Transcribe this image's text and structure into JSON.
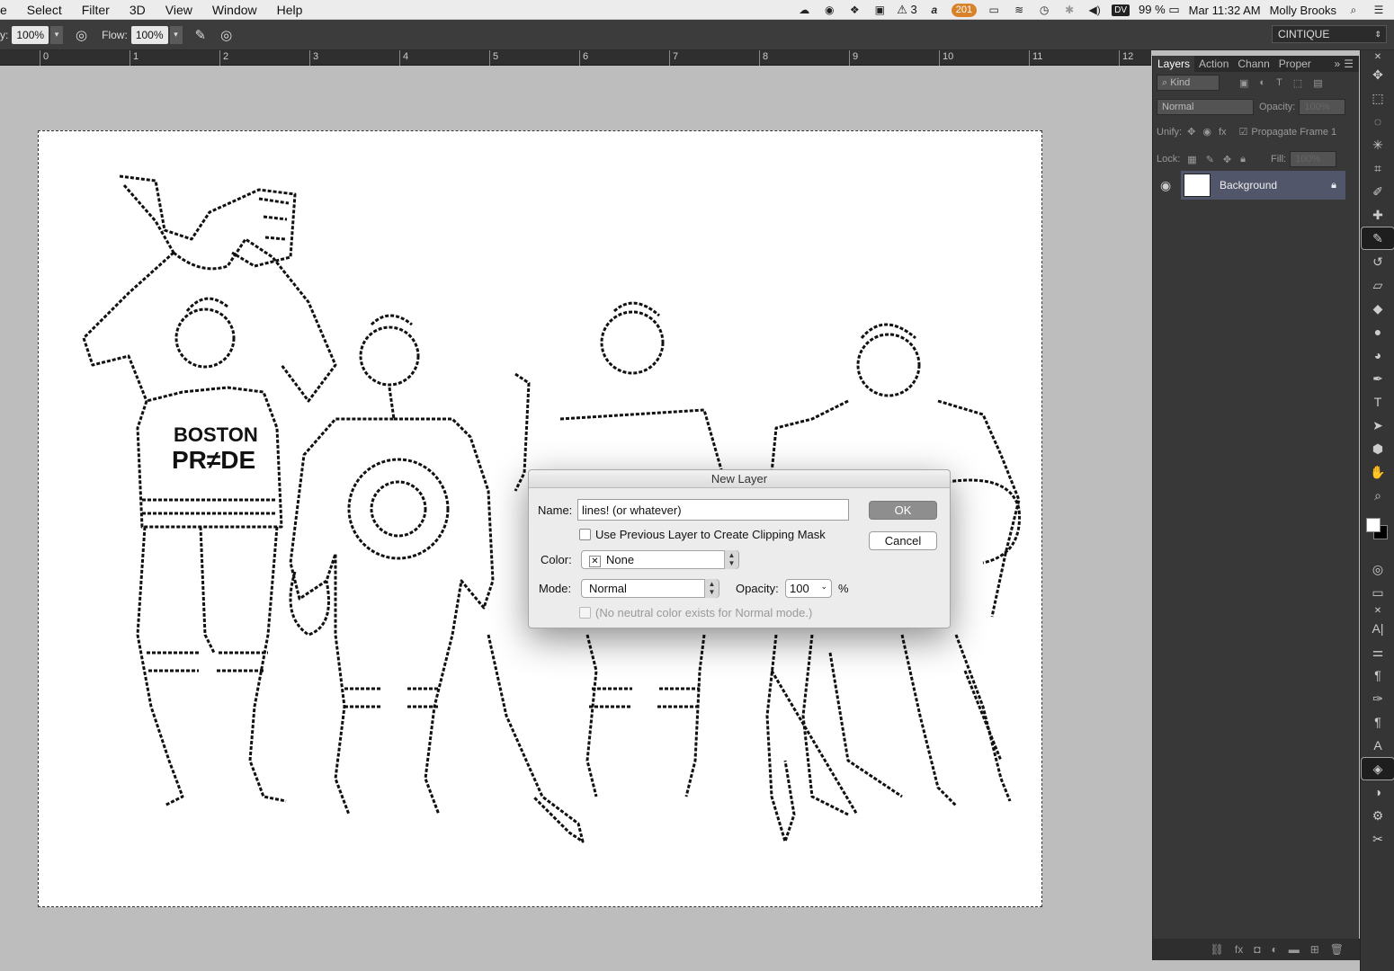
{
  "menubar": {
    "items": [
      "e",
      "Select",
      "Filter",
      "3D",
      "View",
      "Window",
      "Help"
    ],
    "status": {
      "notifications_count": "3",
      "badge_count": "201",
      "dv_label": "DV",
      "battery": "99 %",
      "datetime": "Mar 11:32 AM",
      "user": "Molly Brooks"
    }
  },
  "options_bar": {
    "opacity_prefix": "y:",
    "opacity_value": "100%",
    "flow_label": "Flow:",
    "flow_value": "100%",
    "workspace": "CINTIQUE"
  },
  "ruler": {
    "marks": [
      "0",
      "1",
      "2",
      "3",
      "4",
      "5",
      "6",
      "7",
      "8",
      "9",
      "10",
      "11",
      "12"
    ]
  },
  "dialog": {
    "title": "New Layer",
    "name_label": "Name:",
    "name_value": "lines! (or whatever)",
    "clipping_label": "Use Previous Layer to Create Clipping Mask",
    "color_label": "Color:",
    "color_value": "None",
    "mode_label": "Mode:",
    "mode_value": "Normal",
    "opacity_label": "Opacity:",
    "opacity_value": "100",
    "opacity_unit": "%",
    "neutral_label": "(No neutral color exists for Normal mode.)",
    "ok_label": "OK",
    "cancel_label": "Cancel"
  },
  "layers_panel": {
    "tabs": [
      "Layers",
      "Action",
      "Chann",
      "Proper"
    ],
    "kind_label": "Kind",
    "blend_mode": "Normal",
    "opacity_label": "Opacity:",
    "opacity_value": "100%",
    "unify_label": "Unify:",
    "propagate_label": "Propagate Frame 1",
    "lock_label": "Lock:",
    "fill_label": "Fill:",
    "fill_value": "100%",
    "layers": [
      {
        "name": "Background",
        "visible": true,
        "locked": true
      }
    ]
  },
  "colors": {
    "selected_layer": "#52566a",
    "panel_bg": "#383838",
    "ok_button": "#8e8e8e"
  }
}
